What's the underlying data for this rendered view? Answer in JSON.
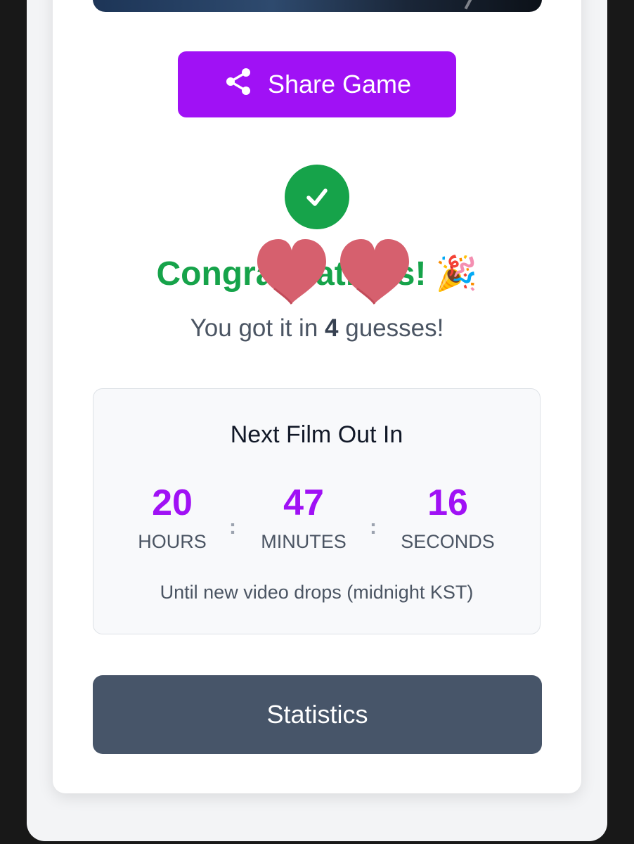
{
  "share": {
    "label": "Share Game"
  },
  "result": {
    "heading": "Congratulations!",
    "emoji": "🎉",
    "guesses_prefix": "You got it in ",
    "guesses_count": "4",
    "guesses_suffix": " guesses!"
  },
  "countdown": {
    "title": "Next Film Out In",
    "hours": "20",
    "minutes": "47",
    "seconds": "16",
    "hours_label": "HOURS",
    "minutes_label": "MINUTES",
    "seconds_label": "SECONDS",
    "separator": ":",
    "note": "Until new video drops (midnight KST)"
  },
  "statistics": {
    "label": "Statistics"
  },
  "colors": {
    "accent": "#a011f5",
    "success": "#16a34a",
    "stats_button": "#475569",
    "heart_sticker": "#d6606e"
  },
  "icons": [
    "share-icon",
    "checkmark-icon",
    "party-popper-icon",
    "heart-sticker-icon"
  ]
}
